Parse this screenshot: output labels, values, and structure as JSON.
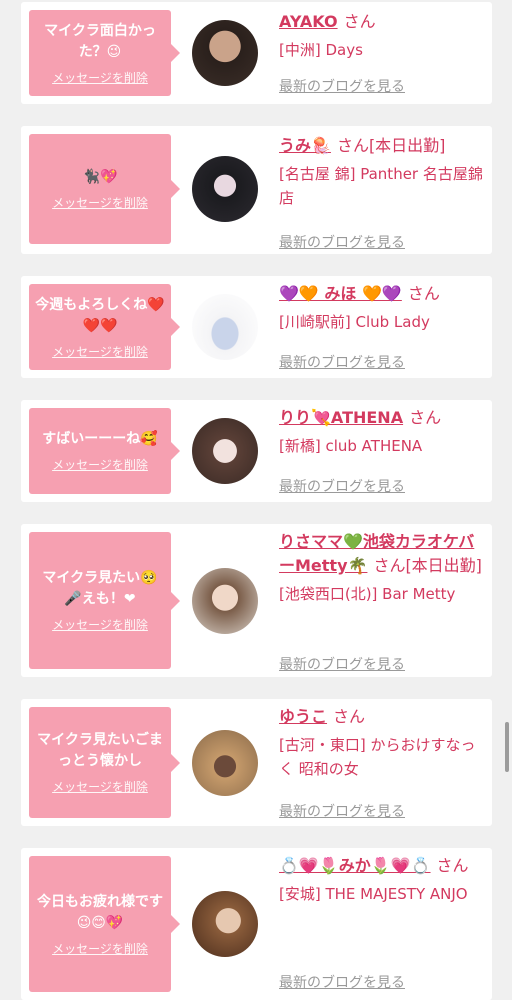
{
  "cards": [
    {
      "message": "マイクラ面白かった？😉",
      "delete_label": "メッセージを削除",
      "name": "AYAKO",
      "suffix": "さん",
      "shop": "[中洲] Days",
      "blog_label": "最新のブログを見る"
    },
    {
      "message": "🐈‍⬛💖",
      "delete_label": "メッセージを削除",
      "name": "うみ🪼",
      "suffix": "さん[本日出勤]",
      "shop": "[名古屋 錦] Panther 名古屋錦店",
      "blog_label": "最新のブログを見る"
    },
    {
      "message": "今週もよろしくね❤️❤️❤️",
      "delete_label": "メッセージを削除",
      "name": "💜🧡 みほ 🧡💜",
      "suffix": "さん",
      "shop": "[川崎駅前] Club Lady",
      "blog_label": "最新のブログを見る"
    },
    {
      "message": "すばいーーーね🥰",
      "delete_label": "メッセージを削除",
      "name": "りり💘ATHENA",
      "suffix": "さん",
      "shop": "[新橋] club ATHENA",
      "blog_label": "最新のブログを見る"
    },
    {
      "message": "マイクラ見たい🥺🎤えも！❤",
      "delete_label": "メッセージを削除",
      "name": "りさママ💚池袋カラオケバーMetty🌴",
      "suffix": "さん[本日出勤]",
      "shop": "[池袋西口(北)] Bar Metty",
      "blog_label": "最新のブログを見る"
    },
    {
      "message": "マイクラ見たいごまっとう懐かし",
      "delete_label": "メッセージを削除",
      "name": "ゆうこ",
      "suffix": "さん",
      "shop": "[古河・東口] からおけすなっく 昭和の女",
      "blog_label": "最新のブログを見る"
    },
    {
      "message": "今日もお疲れ様です😉😊💖",
      "delete_label": "メッセージを削除",
      "name": "💍💗🌷みか🌷💗💍",
      "suffix": "さん",
      "shop": "[安城] THE MAJESTY ANJO",
      "blog_label": "最新のブログを見る"
    }
  ]
}
